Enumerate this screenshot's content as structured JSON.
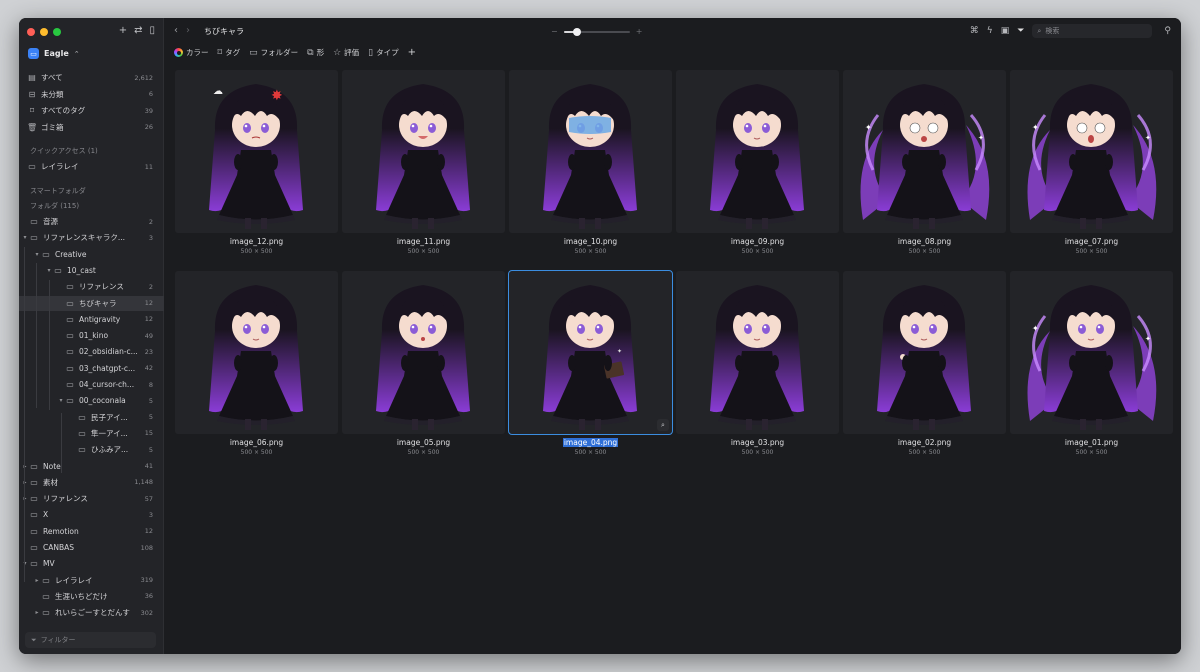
{
  "window": {
    "traffic_colors": [
      "#ff5f57",
      "#febc2e",
      "#28c840"
    ]
  },
  "sidebar": {
    "library_name": "Eagle",
    "library_caret": "⌃",
    "top_items": [
      {
        "label": "すべて",
        "count": "2,612",
        "icon": "all-items-icon"
      },
      {
        "label": "未分類",
        "count": "6",
        "icon": "uncategorized-icon"
      },
      {
        "label": "すべてのタグ",
        "count": "39",
        "icon": "tag-icon"
      },
      {
        "label": "ゴミ箱",
        "count": "26",
        "icon": "trash-icon"
      }
    ],
    "quick_access_title": "クイックアクセス (1)",
    "quick_access_items": [
      {
        "label": "レイラレイ",
        "count": "11"
      }
    ],
    "smart_folders_title": "スマートフォルダ",
    "folders_title": "フォルダ (115)",
    "folders": [
      {
        "label": "音源",
        "count": "2",
        "depth": 0,
        "caret": ""
      },
      {
        "label": "リファレンスキャラク...",
        "count": "3",
        "depth": 0,
        "caret": "▾"
      },
      {
        "label": "Creative",
        "count": "",
        "depth": 1,
        "caret": "▾"
      },
      {
        "label": "10_cast",
        "count": "",
        "depth": 2,
        "caret": "▾"
      },
      {
        "label": "リファレンス",
        "count": "2",
        "depth": 3,
        "caret": ""
      },
      {
        "label": "ちびキャラ",
        "count": "12",
        "depth": 3,
        "caret": "",
        "selected": true
      },
      {
        "label": "Antigravity",
        "count": "12",
        "depth": 3,
        "caret": ""
      },
      {
        "label": "01_kino",
        "count": "49",
        "depth": 3,
        "caret": ""
      },
      {
        "label": "02_obsidian-c...",
        "count": "23",
        "depth": 3,
        "caret": ""
      },
      {
        "label": "03_chatgpt-c...",
        "count": "42",
        "depth": 3,
        "caret": ""
      },
      {
        "label": "04_cursor-ch...",
        "count": "8",
        "depth": 3,
        "caret": ""
      },
      {
        "label": "00_coconala",
        "count": "5",
        "depth": 3,
        "caret": "▾"
      },
      {
        "label": "民子アイ...",
        "count": "5",
        "depth": 4,
        "caret": ""
      },
      {
        "label": "隼一アイ...",
        "count": "15",
        "depth": 4,
        "caret": ""
      },
      {
        "label": "ひふみア...",
        "count": "5",
        "depth": 4,
        "caret": ""
      },
      {
        "label": "Note",
        "count": "41",
        "depth": 0,
        "caret": "▸"
      },
      {
        "label": "素材",
        "count": "1,148",
        "depth": 0,
        "caret": "▸"
      },
      {
        "label": "リファレンス",
        "count": "57",
        "depth": 0,
        "caret": "▸"
      },
      {
        "label": "X",
        "count": "3",
        "depth": 0,
        "caret": ""
      },
      {
        "label": "Remotion",
        "count": "12",
        "depth": 0,
        "caret": ""
      },
      {
        "label": "CANBAS",
        "count": "108",
        "depth": 0,
        "caret": ""
      },
      {
        "label": "MV",
        "count": "",
        "depth": 0,
        "caret": "▾"
      },
      {
        "label": "レイラレイ",
        "count": "319",
        "depth": 1,
        "caret": "▸"
      },
      {
        "label": "生涯いちどだけ",
        "count": "36",
        "depth": 1,
        "caret": ""
      },
      {
        "label": "れいらごーすとだんす",
        "count": "302",
        "depth": 1,
        "caret": "▸"
      }
    ],
    "filter_placeholder": "フィルター"
  },
  "toolbar": {
    "breadcrumb": "ちびキャラ",
    "zoom_minus": "−",
    "zoom_plus": "+",
    "zoom_level": 0.2,
    "search_placeholder": "検索"
  },
  "filterbar": {
    "items": [
      {
        "label": "カラー",
        "icon": "color-wheel-icon"
      },
      {
        "label": "タグ",
        "icon": "tag-icon"
      },
      {
        "label": "フォルダー",
        "icon": "folder-icon"
      },
      {
        "label": "形",
        "icon": "shape-icon"
      },
      {
        "label": "評価",
        "icon": "star-icon"
      },
      {
        "label": "タイプ",
        "icon": "file-type-icon"
      }
    ],
    "add_label": "+"
  },
  "grid": {
    "items": [
      {
        "name": "image_12.png",
        "dims": "500 × 500",
        "mood": "angry",
        "aura": false
      },
      {
        "name": "image_11.png",
        "dims": "500 × 500",
        "mood": "happy",
        "aura": false
      },
      {
        "name": "image_10.png",
        "dims": "500 × 500",
        "mood": "pale",
        "aura": false
      },
      {
        "name": "image_09.png",
        "dims": "500 × 500",
        "mood": "worried",
        "aura": false
      },
      {
        "name": "image_08.png",
        "dims": "500 × 500",
        "mood": "shock",
        "aura": true
      },
      {
        "name": "image_07.png",
        "dims": "500 × 500",
        "mood": "scream",
        "aura": true
      },
      {
        "name": "image_06.png",
        "dims": "500 × 500",
        "mood": "think",
        "aura": false
      },
      {
        "name": "image_05.png",
        "dims": "500 × 500",
        "mood": "surprise",
        "aura": false
      },
      {
        "name": "image_04.png",
        "dims": "500 × 500",
        "mood": "book",
        "aura": false,
        "selected": true
      },
      {
        "name": "image_03.png",
        "dims": "500 × 500",
        "mood": "smug",
        "aura": false
      },
      {
        "name": "image_02.png",
        "dims": "500 × 500",
        "mood": "point",
        "aura": false
      },
      {
        "name": "image_01.png",
        "dims": "500 × 500",
        "mood": "magic",
        "aura": true
      }
    ]
  },
  "colors": {
    "accent": "#3b8de0",
    "hair": "#1a1420",
    "hair_tip": "#8a3cd6",
    "dress": "#141218",
    "skin": "#f5dccf",
    "eye": "#8b5cd6",
    "aura": "#9b45e8"
  }
}
